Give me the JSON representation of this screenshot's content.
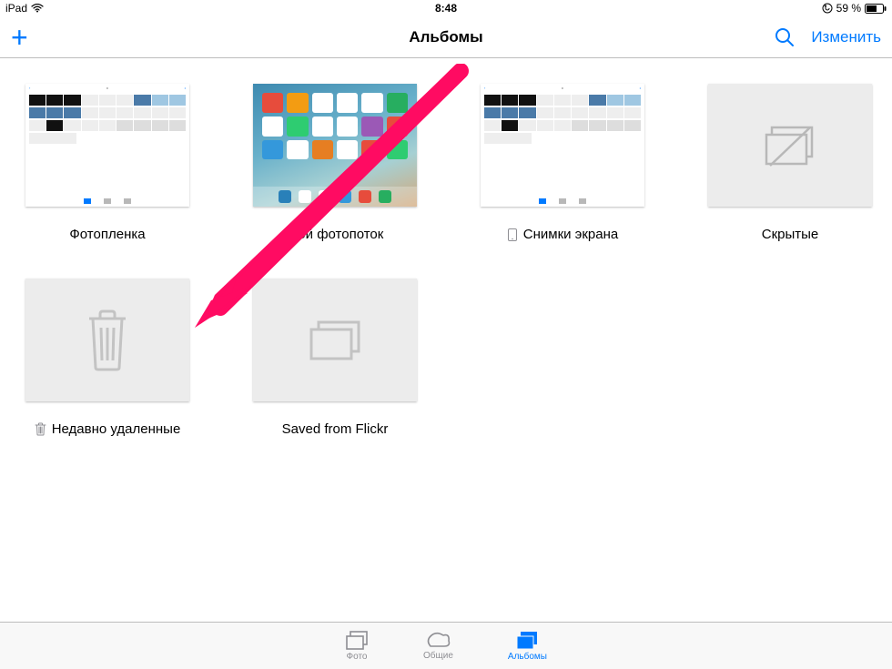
{
  "status": {
    "carrier": "iPad",
    "wifi_icon": "wifi-icon",
    "time": "8:48",
    "orientation_lock": "orientation-lock-icon",
    "battery_percent": "59 %",
    "battery_icon": "battery-icon"
  },
  "nav": {
    "add_label": "+",
    "title": "Альбомы",
    "search_icon": "search-icon",
    "edit_label": "Изменить"
  },
  "albums": [
    {
      "id": "camera-roll",
      "title": "Фотопленка",
      "thumb": "photo-roll",
      "icon": null
    },
    {
      "id": "photo-stream",
      "title": "Мой фотопоток",
      "thumb": "homescreen",
      "icon": null
    },
    {
      "id": "screenshots",
      "title": "Снимки экрана",
      "thumb": "photo-roll",
      "icon": "device-icon"
    },
    {
      "id": "hidden",
      "title": "Скрытые",
      "thumb": "empty-hidden",
      "icon": null
    },
    {
      "id": "recently-deleted",
      "title": "Недавно удаленные",
      "thumb": "trash",
      "icon": "trash-icon"
    },
    {
      "id": "saved-flickr",
      "title": "Saved from Flickr",
      "thumb": "stack",
      "icon": null
    }
  ],
  "tabs": [
    {
      "id": "photos",
      "label": "Фото",
      "icon": "photos-tab-icon",
      "active": false
    },
    {
      "id": "shared",
      "label": "Общие",
      "icon": "shared-tab-icon",
      "active": false
    },
    {
      "id": "albums",
      "label": "Альбомы",
      "icon": "albums-tab-icon",
      "active": true
    }
  ],
  "annotation": {
    "arrow_color": "#ff0b62"
  }
}
